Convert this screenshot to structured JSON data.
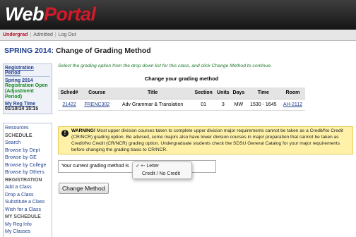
{
  "header": {
    "logo_part1": "Web",
    "logo_part2": "Portal",
    "logo_colors": {
      "web": "#ffffff",
      "portal": "#d41a2a"
    }
  },
  "nav": {
    "items": [
      {
        "label": "Undergrad",
        "active": true
      },
      {
        "label": "Admitted",
        "active": false
      },
      {
        "label": "Log Out",
        "active": false
      }
    ],
    "separator": "|"
  },
  "page": {
    "term": "SPRING 2014:",
    "title": "Change of Grading Method",
    "instructions": "Select the grading option from the drop down list for this class, and click Change Method to continue.",
    "subheading": "Change your grading method"
  },
  "sidebar": {
    "registration_period_header": "Registration Period",
    "term": "Spring 2014",
    "status": "Registration Open (Adjustment Period)",
    "reg_time_header": "My Reg Time",
    "reg_time": "01/10/14 15:15",
    "menu": [
      {
        "label": "Resources",
        "type": "link"
      },
      {
        "label": "SCHEDULE",
        "type": "section"
      },
      {
        "label": "Search",
        "type": "link"
      },
      {
        "label": "Browse by Dept",
        "type": "link"
      },
      {
        "label": "Browse by GE",
        "type": "link"
      },
      {
        "label": "Browse by College",
        "type": "link"
      },
      {
        "label": "Browse by Others",
        "type": "link"
      },
      {
        "label": "REGISTRATION",
        "type": "section"
      },
      {
        "label": "Add a Class",
        "type": "link"
      },
      {
        "label": "Drop a Class",
        "type": "link"
      },
      {
        "label": "Substitute a Class",
        "type": "link"
      },
      {
        "label": "Wish for a Class",
        "type": "link"
      },
      {
        "label": "MY SCHEDULE",
        "type": "section"
      },
      {
        "label": "My Reg Info",
        "type": "link"
      },
      {
        "label": "My Classes",
        "type": "link"
      }
    ]
  },
  "schedule_table": {
    "columns": [
      "Sched#",
      "Course",
      "Title",
      "Section",
      "Units",
      "Days",
      "Time",
      "Room"
    ],
    "rows": [
      {
        "sched": "21422",
        "course": "FRENC302",
        "title": "Adv Grammar & Translation",
        "section": "01",
        "units": "3",
        "days": "MW",
        "time": "1530 - 1645",
        "room": "AH-2112"
      }
    ]
  },
  "warning": {
    "label": "WARNING!",
    "text": "Most upper division courses taken to complete upper division major requirements cannot be taken as a Credit/No Credit (CR/NCR) grading option. Be advised, some majors also have lower division courses in major preparation that cannot be taken as Credit/No Credit (CR/NCR) grading option. Undergraduate students check the SDSU General Catalog for your major requirements before changing the grading basis to CR/NCR."
  },
  "grading": {
    "label": "Your current grading method is",
    "options": [
      {
        "label": "+- Letter",
        "selected": true
      },
      {
        "label": "Credit / No Credit",
        "selected": false
      }
    ],
    "checkmark": "✓"
  },
  "button": {
    "label": "Change Method"
  }
}
